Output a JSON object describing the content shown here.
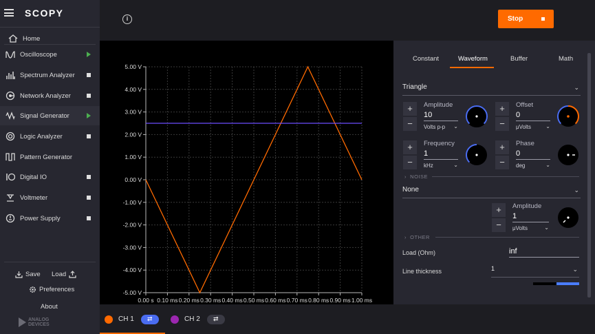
{
  "app": {
    "name": "SCOPY"
  },
  "sidebar": {
    "home": "Home",
    "items": [
      {
        "label": "Oscilloscope",
        "icon": "oscilloscope-icon",
        "status": "running"
      },
      {
        "label": "Spectrum Analyzer",
        "icon": "spectrum-icon",
        "status": "stopped"
      },
      {
        "label": "Network Analyzer",
        "icon": "network-icon",
        "status": "stopped"
      },
      {
        "label": "Signal Generator",
        "icon": "signal-icon",
        "status": "running"
      },
      {
        "label": "Logic Analyzer",
        "icon": "logic-icon",
        "status": "stopped"
      },
      {
        "label": "Pattern Generator",
        "icon": "pattern-icon",
        "status": "none"
      },
      {
        "label": "Digital IO",
        "icon": "digital-io-icon",
        "status": "stopped"
      },
      {
        "label": "Voltmeter",
        "icon": "voltmeter-icon",
        "status": "stopped"
      },
      {
        "label": "Power Supply",
        "icon": "power-icon",
        "status": "stopped"
      }
    ],
    "save": "Save",
    "load": "Load",
    "preferences": "Preferences",
    "about": "About",
    "logo_line1": "ANALOG",
    "logo_line2": "DEVICES"
  },
  "toolbar": {
    "stop_label": "Stop",
    "accent": "#ff6a00"
  },
  "plot": {
    "y_ticks": [
      "5.00 V",
      "4.00 V",
      "3.00 V",
      "2.00 V",
      "1.00 V",
      "0.00 V",
      "-1.00 V",
      "-2.00 V",
      "-3.00 V",
      "-4.00 V",
      "-5.00 V"
    ],
    "x_ticks": [
      "0.00 s",
      "0.10 ms",
      "0.20 ms",
      "0.30 ms",
      "0.40 ms",
      "0.50 ms",
      "0.60 ms",
      "0.70 ms",
      "0.80 ms",
      "0.90 ms",
      "1.00 ms"
    ]
  },
  "chart_data": {
    "type": "line",
    "xlim": [
      0,
      1.0
    ],
    "ylim": [
      -5,
      5
    ],
    "grid": true,
    "series": [
      {
        "color": "#ff6a00",
        "x": [
          0,
          0.25,
          0.75,
          1.0
        ],
        "y": [
          0,
          -5,
          5,
          0
        ]
      },
      {
        "color": "#6b4cff",
        "x": [
          0,
          1.0
        ],
        "y": [
          2.5,
          2.5
        ]
      }
    ]
  },
  "channels": [
    {
      "label": "CH 1",
      "color": "#ff6a00"
    },
    {
      "label": "CH 2",
      "color": "#9c27b0"
    }
  ],
  "panel": {
    "tabs": [
      "Constant",
      "Waveform",
      "Buffer",
      "Math"
    ],
    "active_tab": "Waveform",
    "waveform_type": "Triangle",
    "amplitude": {
      "title": "Amplitude",
      "value": "10",
      "unit": "Volts p-p"
    },
    "offset": {
      "title": "Offset",
      "value": "0",
      "unit": "μVolts"
    },
    "frequency": {
      "title": "Frequency",
      "value": "1",
      "unit": "kHz"
    },
    "phase": {
      "title": "Phase",
      "value": "0",
      "unit": "deg"
    },
    "noise_section": "NOISE",
    "noise_type": "None",
    "noise_amplitude": {
      "title": "Amplitude",
      "value": "1",
      "unit": "μVolts"
    },
    "other_section": "OTHER",
    "load_label": "Load (Ohm)",
    "load_value": "inf",
    "line_thickness_label": "Line thickness",
    "line_thickness_value": "1"
  }
}
